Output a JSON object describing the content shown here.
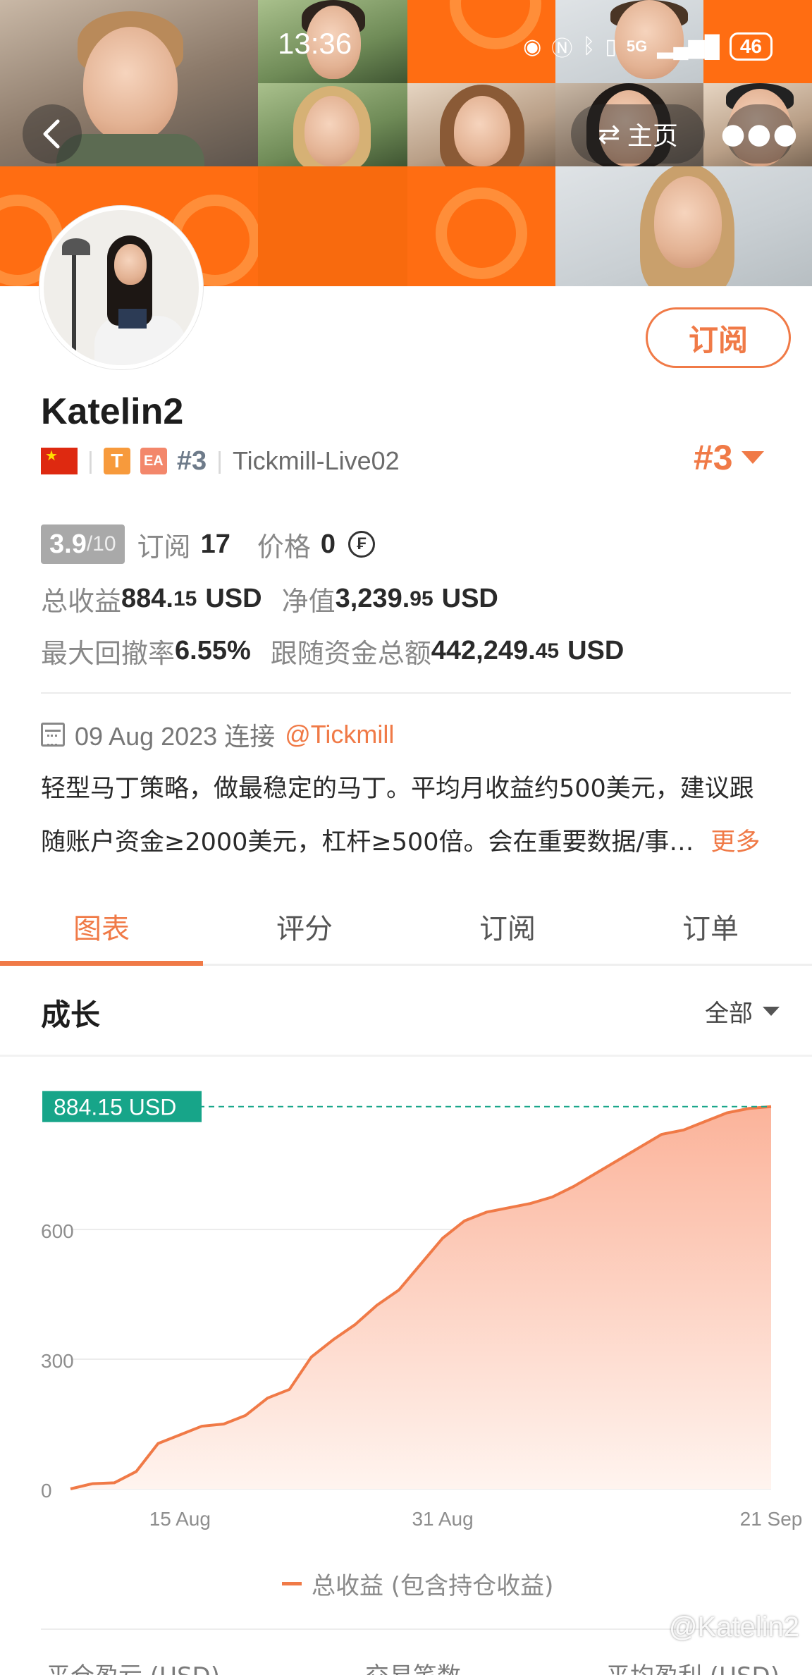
{
  "status_bar": {
    "time": "13:36",
    "network": "5G",
    "battery": "46"
  },
  "header": {
    "home_label": "主页"
  },
  "profile": {
    "subscribe_label": "订阅",
    "username": "Katelin2",
    "badge_t": "T",
    "badge_ea": "EA",
    "rank_small": "#3",
    "broker": "Tickmill-Live02",
    "rank_big": "#3",
    "score": "3.9",
    "score_max": "/10",
    "subscriptions_label": "订阅",
    "subscriptions_value": "17",
    "price_label": "价格",
    "price_value": "0",
    "total_profit_label": "总收益",
    "total_profit_int": "884.",
    "total_profit_dec": "15",
    "total_profit_unit": "USD",
    "equity_label": "净值",
    "equity_int": "3,239.",
    "equity_dec": "95",
    "equity_unit": "USD",
    "max_drawdown_label": "最大回撤率",
    "max_drawdown_value": "6.55%",
    "follow_funds_label": "跟随资金总额",
    "follow_funds_int": "442,249.",
    "follow_funds_dec": "45",
    "follow_funds_unit": "USD",
    "date": "09 Aug 2023 连接",
    "connected_to": "@Tickmill",
    "description_line1": "轻型马丁策略，做最稳定的马丁。平均月收益约500美元，建议跟",
    "description_line2": "随账户资金≥2000美元，杠杆≥500倍。会在重要数据/事…",
    "more_label": "更多"
  },
  "tabs": [
    {
      "label": "图表",
      "active": true
    },
    {
      "label": "评分",
      "active": false
    },
    {
      "label": "订阅",
      "active": false
    },
    {
      "label": "订单",
      "active": false
    }
  ],
  "growth": {
    "title": "成长",
    "range_label": "全部"
  },
  "chart_data": {
    "type": "area",
    "x": [
      "09 Aug",
      "10 Aug",
      "11 Aug",
      "12 Aug",
      "14 Aug",
      "15 Aug",
      "16 Aug",
      "17 Aug",
      "18 Aug",
      "21 Aug",
      "22 Aug",
      "23 Aug",
      "24 Aug",
      "25 Aug",
      "28 Aug",
      "29 Aug",
      "30 Aug",
      "31 Aug",
      "01 Sep",
      "04 Sep",
      "05 Sep",
      "06 Sep",
      "07 Sep",
      "08 Sep",
      "11 Sep",
      "12 Sep",
      "13 Sep",
      "14 Sep",
      "15 Sep",
      "18 Sep",
      "19 Sep",
      "20 Sep",
      "21 Sep"
    ],
    "series": [
      {
        "name": "总收益 (包含持仓收益)",
        "values": [
          0,
          12,
          14,
          40,
          105,
          125,
          145,
          150,
          170,
          210,
          230,
          305,
          345,
          380,
          425,
          460,
          520,
          580,
          620,
          640,
          650,
          660,
          675,
          700,
          730,
          760,
          790,
          820,
          830,
          850,
          870,
          880,
          884.15
        ]
      }
    ],
    "yticks": [
      0,
      300,
      600
    ],
    "xticks": [
      "15 Aug",
      "31 Aug",
      "21 Sep"
    ],
    "ylim": [
      0,
      900
    ],
    "current_label": "884.15 USD",
    "grid": true,
    "legend": "bottom-center",
    "colors": {
      "line": "#f07a47",
      "fill_top": "#fbb39a",
      "fill_bottom": "#fff4ef",
      "label_bg": "#17a589",
      "ref_line": "#17a589"
    }
  },
  "bottom_stats": {
    "labels": [
      "平仓盈亏 (USD)",
      "交易笔数",
      "平均盈利 (USD)"
    ]
  },
  "watermark": "@Katelin2",
  "colors": {
    "accent": "#f07a47",
    "banner": "#ff6d12"
  }
}
